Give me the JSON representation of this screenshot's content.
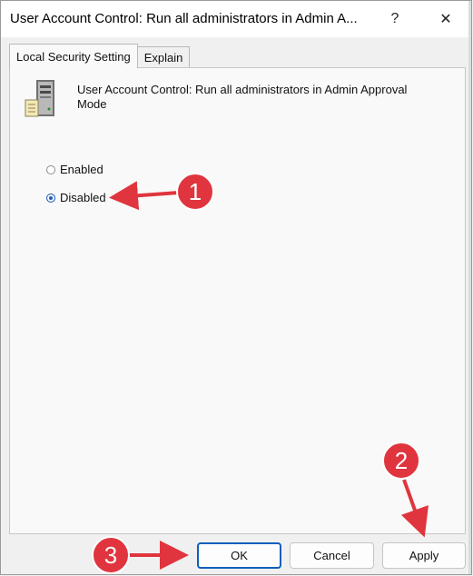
{
  "window": {
    "title": "User Account Control: Run all administrators in Admin A...",
    "help_glyph": "?",
    "close_glyph": "✕"
  },
  "tabs": [
    {
      "label": "Local Security Setting"
    },
    {
      "label": "Explain"
    }
  ],
  "setting": {
    "title_line1": "User Account Control: Run all administrators in Admin Approval",
    "title_line2": "Mode"
  },
  "options": [
    {
      "label": "Enabled",
      "selected": false
    },
    {
      "label": "Disabled",
      "selected": true
    }
  ],
  "buttons": {
    "ok": "OK",
    "cancel": "Cancel",
    "apply": "Apply"
  },
  "annotations": [
    {
      "number": "1"
    },
    {
      "number": "2"
    },
    {
      "number": "3"
    }
  ],
  "colors": {
    "annotation_red": "#e0353e",
    "radio_selected": "#1f5fb5"
  }
}
